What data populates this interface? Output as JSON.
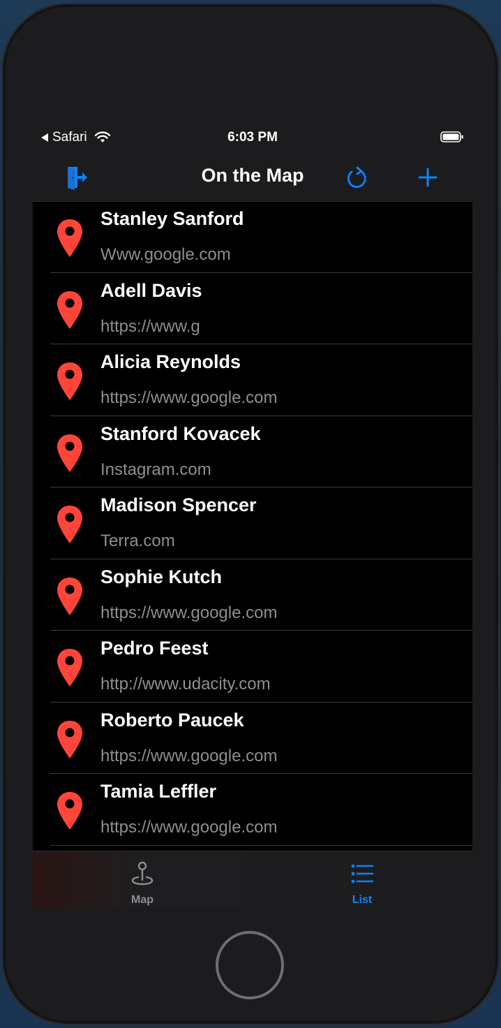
{
  "status_bar": {
    "back_app": "Safari",
    "time": "6:03 PM"
  },
  "nav_bar": {
    "title": "On the Map",
    "logout_icon": "logout-icon",
    "refresh_icon": "refresh-icon",
    "add_icon": "plus-icon"
  },
  "colors": {
    "accent": "#0a84ff",
    "pin": "#ff453a"
  },
  "list": {
    "items": [
      {
        "name": "Stanley Sanford",
        "url": "Www.google.com"
      },
      {
        "name": "Adell Davis",
        "url": "https://www.g"
      },
      {
        "name": "Alicia Reynolds",
        "url": "https://www.google.com"
      },
      {
        "name": "Stanford Kovacek",
        "url": "Instagram.com"
      },
      {
        "name": "Madison Spencer",
        "url": "Terra.com"
      },
      {
        "name": "Sophie Kutch",
        "url": "https://www.google.com"
      },
      {
        "name": "Pedro Feest",
        "url": "http://www.udacity.com"
      },
      {
        "name": "Roberto Paucek",
        "url": "https://www.google.com"
      },
      {
        "name": "Tamia Leffler",
        "url": "https://www.google.com"
      }
    ]
  },
  "tab_bar": {
    "tabs": [
      {
        "label": "Map",
        "icon": "map-pin-icon",
        "selected": false
      },
      {
        "label": "List",
        "icon": "list-icon",
        "selected": true
      }
    ]
  }
}
